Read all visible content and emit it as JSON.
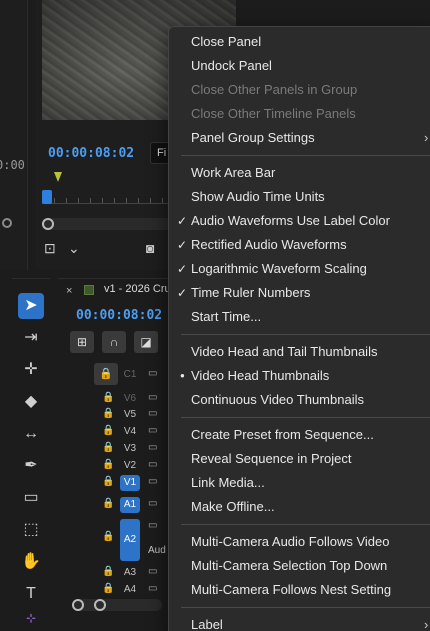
{
  "left_strip": {
    "timecode_fragment": "0:00"
  },
  "program_monitor": {
    "timecode": "00:00:08:02",
    "fit_label": "Fi"
  },
  "tools": [
    "selection-tool",
    "track-select-tool",
    "ripple-edit-tool",
    "razor-tool",
    "slip-tool",
    "pen-tool",
    "rectangle-tool",
    "type-on-tool",
    "hand-tool",
    "type-tool"
  ],
  "timeline": {
    "close_glyph": "×",
    "tab_title": "v1 - 2026 Cru",
    "timecode": "00:00:08:02",
    "tracks": [
      {
        "name": "C1",
        "dim": true
      },
      {
        "name": "V6",
        "dim": true
      },
      {
        "name": "V5"
      },
      {
        "name": "V4"
      },
      {
        "name": "V3"
      },
      {
        "name": "V2"
      },
      {
        "name": "V1",
        "highlighted": true
      },
      {
        "name": "A1",
        "highlighted": true
      },
      {
        "name": "A2",
        "highlighted": true,
        "extra": "Aud"
      },
      {
        "name": "A3"
      },
      {
        "name": "A4"
      }
    ]
  },
  "context_menu": {
    "items": [
      {
        "label": "Close Panel"
      },
      {
        "label": "Undock Panel"
      },
      {
        "label": "Close Other Panels in Group",
        "disabled": true
      },
      {
        "label": "Close Other Timeline Panels",
        "disabled": true
      },
      {
        "label": "Panel Group Settings",
        "submenu": true
      },
      {
        "label": "Work Area Bar"
      },
      {
        "label": "Show Audio Time Units"
      },
      {
        "label": "Audio Waveforms Use Label Color",
        "checked": true
      },
      {
        "label": "Rectified Audio Waveforms",
        "checked": true
      },
      {
        "label": "Logarithmic Waveform Scaling",
        "checked": true
      },
      {
        "label": "Time Ruler Numbers",
        "checked": true
      },
      {
        "label": "Start Time..."
      },
      {
        "label": "Video Head and Tail Thumbnails"
      },
      {
        "label": "Video Head Thumbnails",
        "radio": true
      },
      {
        "label": "Continuous Video Thumbnails"
      },
      {
        "label": "Create Preset from Sequence..."
      },
      {
        "label": "Reveal Sequence in Project"
      },
      {
        "label": "Link Media..."
      },
      {
        "label": "Make Offline..."
      },
      {
        "label": "Multi-Camera Audio Follows Video"
      },
      {
        "label": "Multi-Camera Selection Top Down"
      },
      {
        "label": "Multi-Camera Follows Nest Setting"
      },
      {
        "label": "Label",
        "submenu": true
      }
    ],
    "check_glyph": "✓",
    "radio_glyph": "●",
    "submenu_glyph": "›"
  },
  "colors": {
    "accent_blue": "#2d73c8",
    "timecode_blue": "#4a9ff5",
    "menu_bg": "#2b2b2b"
  }
}
